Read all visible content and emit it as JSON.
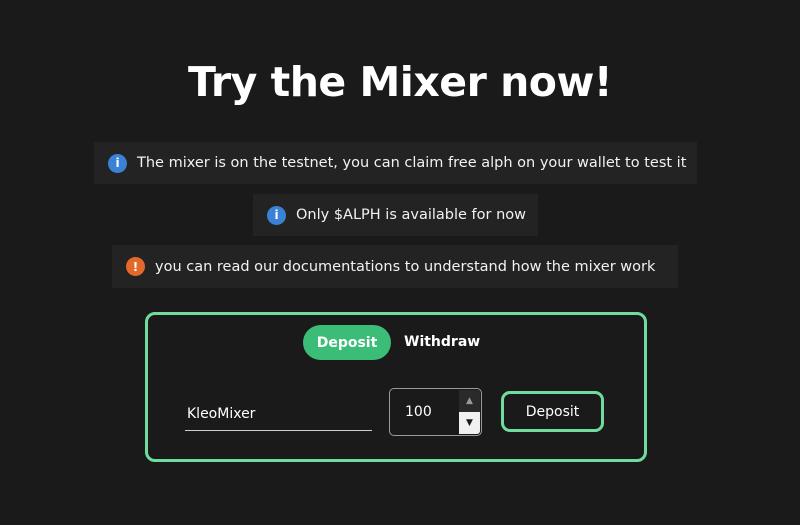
{
  "page": {
    "title": "Try the Mixer now!"
  },
  "notices": [
    {
      "icon": "info-icon",
      "glyph": "i",
      "text": "The mixer is on the testnet, you can claim free alph on your wallet to test it"
    },
    {
      "icon": "info-icon",
      "glyph": "i",
      "text": "Only $ALPH is available for now"
    },
    {
      "icon": "warning-icon",
      "glyph": "!",
      "text": "you can read our documentations to understand how the mixer work"
    }
  ],
  "mixer": {
    "tabs": {
      "deposit_label": "Deposit",
      "withdraw_label": "Withdraw"
    },
    "name_value": "KleoMixer",
    "amount_value": "100",
    "stepper_up": "▲",
    "stepper_down": "▼",
    "deposit_button_label": "Deposit"
  },
  "colors": {
    "background": "#1a1a1a",
    "notice_background": "#232323",
    "accent_green": "#3bbd78",
    "border_green": "#6fdc9e",
    "info_blue": "#3b82d6",
    "warning_orange": "#e2692a"
  }
}
